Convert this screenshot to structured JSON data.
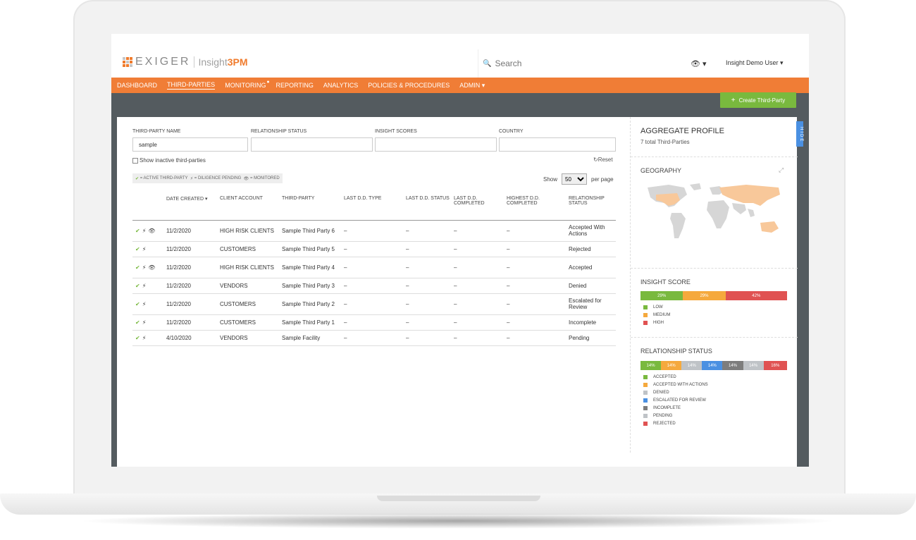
{
  "app": {
    "brand": "EXIGER",
    "product": "Insight",
    "product_suffix": "3PM"
  },
  "search": {
    "placeholder": "Search"
  },
  "user": {
    "name": "Insight Demo User"
  },
  "nav": {
    "items": [
      "DASHBOARD",
      "THIRD-PARTIES",
      "MONITORING",
      "REPORTING",
      "ANALYTICS",
      "POLICIES & PROCEDURES",
      "ADMIN"
    ],
    "active": "THIRD-PARTIES"
  },
  "create_button": "Create Third-Party",
  "filters": {
    "name_label": "THIRD-PARTY NAME",
    "name_value": "sample",
    "status_label": "RELATIONSHIP STATUS",
    "scores_label": "INSIGHT SCORES",
    "country_label": "COUNTRY",
    "show_inactive": "Show inactive third-parties",
    "reset": "Reset"
  },
  "legend_chip": {
    "active": "= ACTIVE THIRD-PARTY",
    "pending": "= DILIGENCE PENDING",
    "monitored": "= MONITORED"
  },
  "paging": {
    "show_label": "Show",
    "per_page_value": "50",
    "per_page_label": "per page"
  },
  "table": {
    "headers": [
      "DATE CREATED",
      "CLIENT ACCOUNT",
      "THIRD-PARTY",
      "LAST D.D. TYPE",
      "LAST D.D. STATUS",
      "LAST D.D. COMPLETED",
      "HIGHEST D.D. COMPLETED",
      "RELATIONSHIP STATUS"
    ],
    "rows": [
      {
        "date": "11/2/2020",
        "account": "HIGH RISK CLIENTS",
        "party": "Sample Third Party 6",
        "dd_type": "–",
        "dd_status": "–",
        "dd_completed": "–",
        "highest": "–",
        "status": "Accepted With Actions"
      },
      {
        "date": "11/2/2020",
        "account": "CUSTOMERS",
        "party": "Sample Third Party 5",
        "dd_type": "–",
        "dd_status": "–",
        "dd_completed": "–",
        "highest": "–",
        "status": "Rejected"
      },
      {
        "date": "11/2/2020",
        "account": "HIGH RISK CLIENTS",
        "party": "Sample Third Party 4",
        "dd_type": "–",
        "dd_status": "–",
        "dd_completed": "–",
        "highest": "–",
        "status": "Accepted"
      },
      {
        "date": "11/2/2020",
        "account": "VENDORS",
        "party": "Sample Third Party 3",
        "dd_type": "–",
        "dd_status": "–",
        "dd_completed": "–",
        "highest": "–",
        "status": "Denied"
      },
      {
        "date": "11/2/2020",
        "account": "CUSTOMERS",
        "party": "Sample Third Party 2",
        "dd_type": "–",
        "dd_status": "–",
        "dd_completed": "–",
        "highest": "–",
        "status": "Escalated for Review"
      },
      {
        "date": "11/2/2020",
        "account": "CUSTOMERS",
        "party": "Sample Third Party 1",
        "dd_type": "–",
        "dd_status": "–",
        "dd_completed": "–",
        "highest": "–",
        "status": "Incomplete"
      },
      {
        "date": "4/10/2020",
        "account": "VENDORS",
        "party": "Sample Facility",
        "dd_type": "–",
        "dd_status": "–",
        "dd_completed": "–",
        "highest": "–",
        "status": "Pending"
      }
    ]
  },
  "aggregate": {
    "title": "AGGREGATE PROFILE",
    "subtitle": "7 total Third-Parties",
    "hide_tab": "HIDE",
    "geography_title": "GEOGRAPHY",
    "insight_title": "INSIGHT SCORE",
    "insight_bar": [
      "29%",
      "29%",
      "42%"
    ],
    "insight_legend": [
      "LOW",
      "MEDIUM",
      "HIGH"
    ],
    "relationship_title": "RELATIONSHIP STATUS",
    "relationship_bar": [
      "14%",
      "14%",
      "14%",
      "14%",
      "14%",
      "14%",
      "16%"
    ],
    "relationship_legend": [
      "ACCEPTED",
      "ACCEPTED WITH ACTIONS",
      "DENIED",
      "ESCALATED FOR REVIEW",
      "INCOMPLETE",
      "PENDING",
      "REJECTED"
    ]
  },
  "colors": {
    "orange": "#f07d36",
    "green": "#79b93e",
    "yellow": "#f5a93d",
    "red": "#e05252",
    "blue": "#4a90e2",
    "grey_light": "#bfc3c7",
    "grey_dark": "#7d7d7d"
  }
}
